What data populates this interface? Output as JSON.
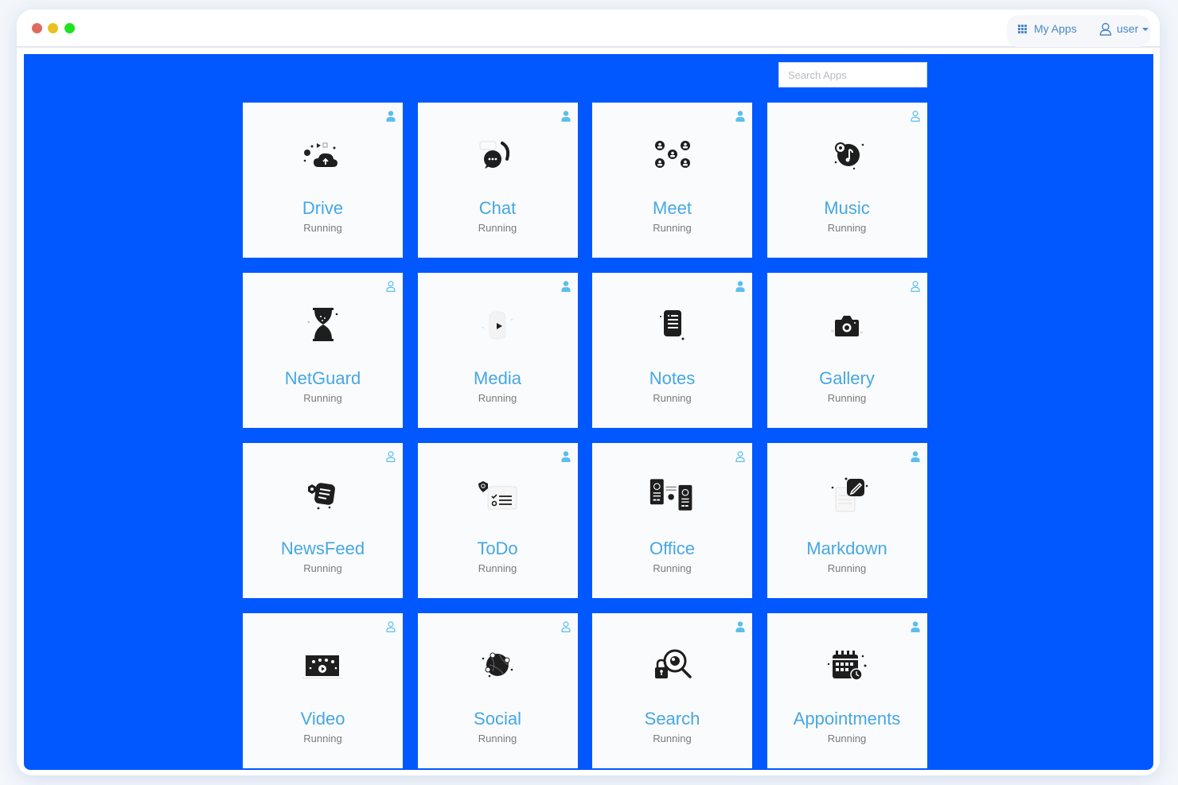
{
  "window": {
    "controls": [
      "close",
      "minimize",
      "maximize"
    ]
  },
  "header": {
    "my_apps_label": "My Apps",
    "my_apps_icon": "grid-icon",
    "user_label": "user",
    "user_icon": "user-outline-icon"
  },
  "search": {
    "placeholder": "Search Apps",
    "value": ""
  },
  "colors": {
    "background": "#0058fe",
    "app_name": "#46a7e3",
    "status": "#7a7a7a",
    "accent": "#4b87c7"
  },
  "apps": [
    {
      "name": "Drive",
      "status": "Running",
      "icon": "cloud-upload-icon",
      "user_badge": "filled"
    },
    {
      "name": "Chat",
      "status": "Running",
      "icon": "chat-bubble-phone-icon",
      "user_badge": "filled"
    },
    {
      "name": "Meet",
      "status": "Running",
      "icon": "people-group-icon",
      "user_badge": "filled"
    },
    {
      "name": "Music",
      "status": "Running",
      "icon": "music-disc-icon",
      "user_badge": "outline"
    },
    {
      "name": "NetGuard",
      "status": "Running",
      "icon": "hourglass-icon",
      "user_badge": "outline"
    },
    {
      "name": "Media",
      "status": "Running",
      "icon": "play-icon",
      "user_badge": "filled"
    },
    {
      "name": "Notes",
      "status": "Running",
      "icon": "notes-document-icon",
      "user_badge": "filled"
    },
    {
      "name": "Gallery",
      "status": "Running",
      "icon": "camera-icon",
      "user_badge": "outline"
    },
    {
      "name": "NewsFeed",
      "status": "Running",
      "icon": "news-feed-icon",
      "user_badge": "outline"
    },
    {
      "name": "ToDo",
      "status": "Running",
      "icon": "checklist-icon",
      "user_badge": "filled"
    },
    {
      "name": "Office",
      "status": "Running",
      "icon": "office-documents-icon",
      "user_badge": "outline"
    },
    {
      "name": "Markdown",
      "status": "Running",
      "icon": "edit-pencil-icon",
      "user_badge": "filled"
    },
    {
      "name": "Video",
      "status": "Running",
      "icon": "video-player-icon",
      "user_badge": "outline"
    },
    {
      "name": "Social",
      "status": "Running",
      "icon": "globe-network-icon",
      "user_badge": "outline"
    },
    {
      "name": "Search",
      "status": "Running",
      "icon": "search-lock-icon",
      "user_badge": "filled"
    },
    {
      "name": "Appointments",
      "status": "Running",
      "icon": "calendar-clock-icon",
      "user_badge": "filled"
    }
  ]
}
